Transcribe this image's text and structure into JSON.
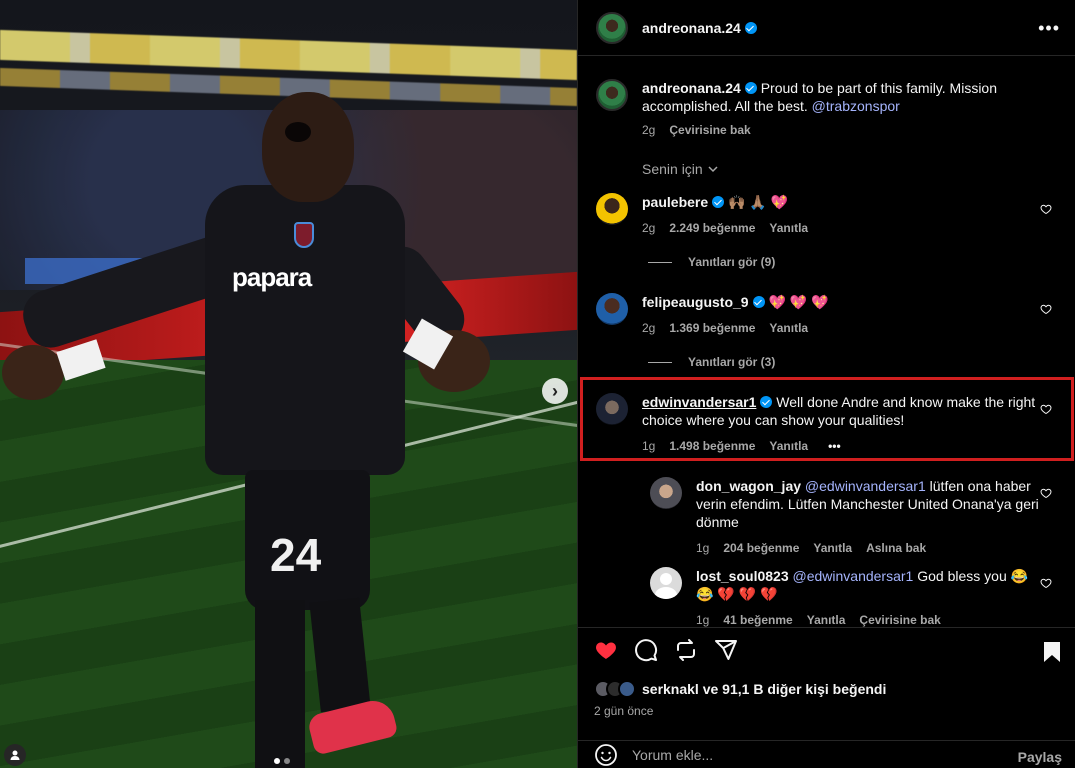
{
  "post": {
    "author": "andreonana.24",
    "caption": "Proud to be part of this family. Mission accomplished. All the best.",
    "caption_mention": "@trabzonspor",
    "caption_time": "2g",
    "caption_translate": "Çevirisine bak",
    "filter_label": "Senin için",
    "jersey_sponsor": "papara",
    "jersey_number": "24"
  },
  "comments": [
    {
      "user": "paulebere",
      "text": "🙌🏽 🙏🏽 💖",
      "time": "2g",
      "likes": "2.249 beğenme",
      "reply": "Yanıtla",
      "view_replies": "Yanıtları gör (9)"
    },
    {
      "user": "felipeaugusto_9",
      "text": "💖 💖 💖",
      "time": "2g",
      "likes": "1.369 beğenme",
      "reply": "Yanıtla",
      "view_replies": "Yanıtları gör (3)"
    },
    {
      "user": "edwinvandersar1",
      "text": "Well done Andre and know make the right choice where you can show your qualities!",
      "time": "1g",
      "likes": "1.498 beğenme",
      "reply": "Yanıtla",
      "more": "•••"
    }
  ],
  "replies": [
    {
      "user": "don_wagon_jay",
      "mention": "@edwinvandersar1",
      "text": "lütfen ona haber verin efendim. Lütfen Manchester United Onana'ya geri dönme",
      "time": "1g",
      "likes": "204 beğenme",
      "reply": "Yanıtla",
      "translate": "Aslına bak"
    },
    {
      "user": "lost_soul0823",
      "mention": "@edwinvandersar1",
      "text": "God bless you 😂",
      "text2": "😂 💔 💔 💔",
      "time": "1g",
      "likes": "41 beğenme",
      "reply": "Yanıtla",
      "translate": "Çevirisine bak"
    }
  ],
  "actions": {
    "liked_by_user": "serknakl",
    "liked_by_rest": "ve 91,1 B diğer kişi beğendi",
    "time_ago": "2 gün önce",
    "comment_placeholder": "Yorum ekle...",
    "post_label": "Paylaş"
  },
  "colors": {
    "like": "#ff3040",
    "highlight": "#d01f1f",
    "verified": "#0095f6",
    "mention": "#a5b4fc"
  },
  "icons": [
    "more-icon",
    "verified-icon",
    "heart-icon",
    "comment-icon",
    "share-icon",
    "send-icon",
    "bookmark-icon",
    "emoji-icon",
    "chevron-down-icon",
    "chevron-right-icon",
    "tag-user-icon"
  ]
}
